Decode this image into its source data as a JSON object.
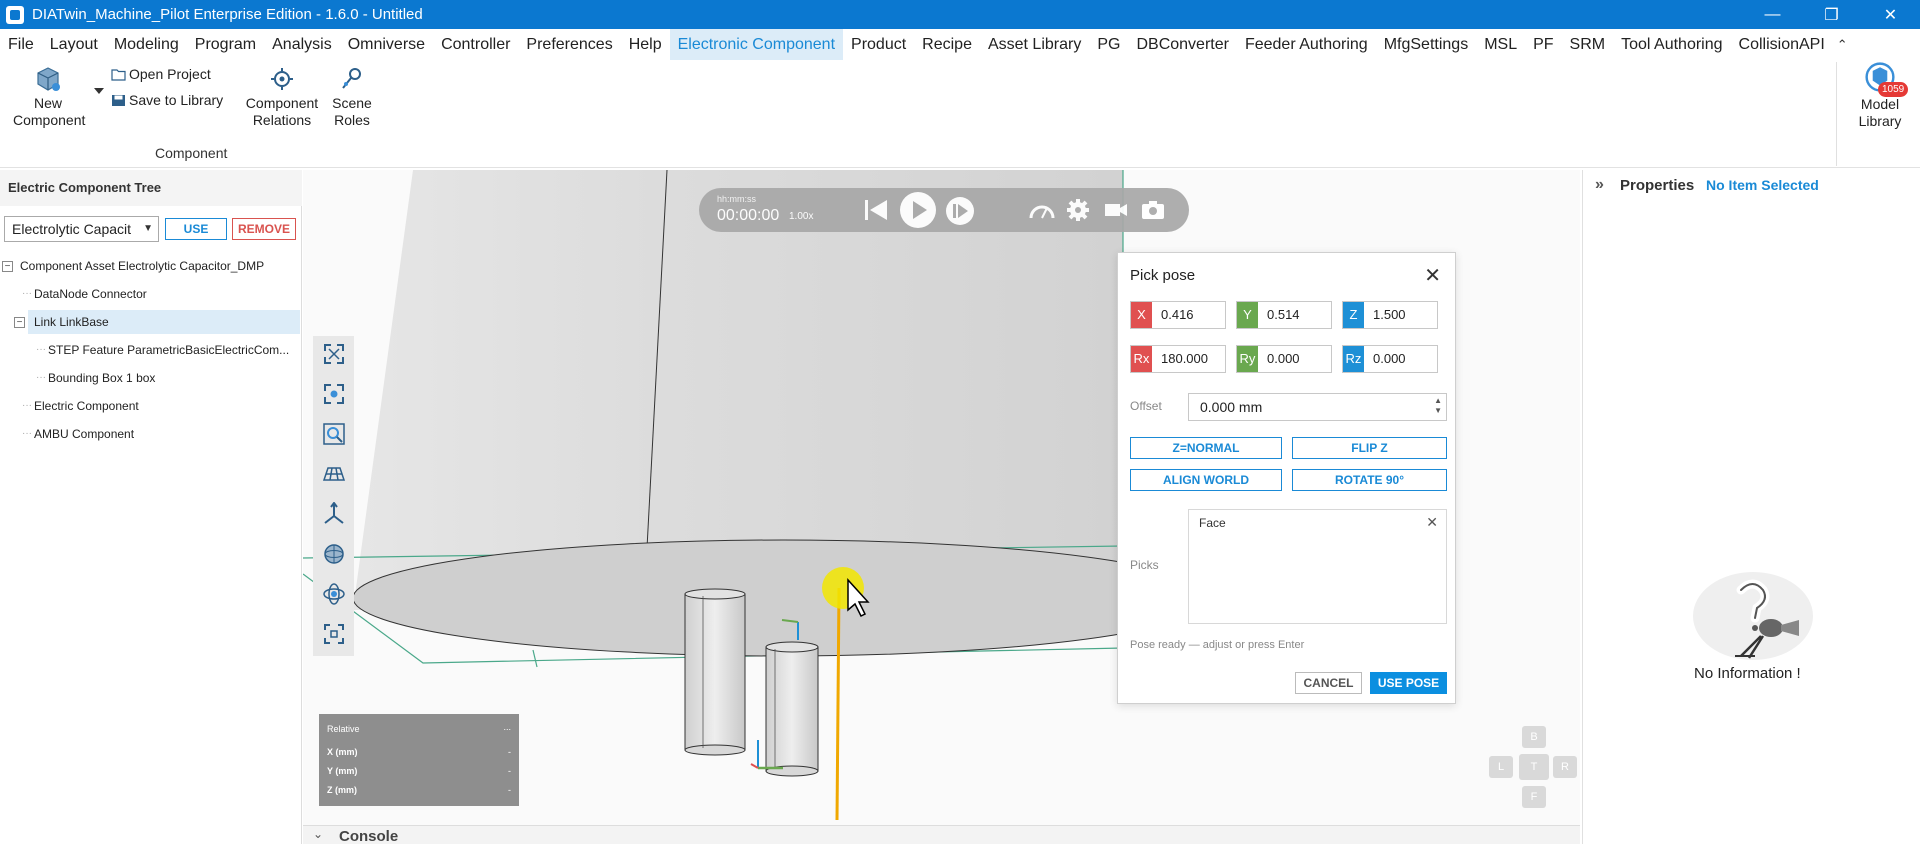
{
  "window": {
    "title": "DIATwin_Machine_Pilot Enterprise Edition - 1.6.0 - Untitled",
    "controls": [
      "—",
      "❐",
      "✕"
    ]
  },
  "menu": {
    "items": [
      "File",
      "Layout",
      "Modeling",
      "Program",
      "Analysis",
      "Omniverse",
      "Controller",
      "Preferences",
      "Help",
      "Electronic Component",
      "Product",
      "Recipe",
      "Asset Library",
      "PG",
      "DBConverter",
      "Feeder Authoring",
      "MfgSettings",
      "MSL",
      "PF",
      "SRM",
      "Tool Authoring",
      "CollisionAPI"
    ],
    "active": "Electronic Component",
    "collapse_glyph": "⌃"
  },
  "ribbon": {
    "new_component": "New Component",
    "open_project": "Open Project",
    "save_to_library": "Save to Library",
    "component_relations": "Component Relations",
    "scene_roles": "Scene Roles",
    "group_label": "Component",
    "model_library": "Model Library",
    "model_library_badge": "1059"
  },
  "left_panel": {
    "title": "Electric Component Tree",
    "combo_value": "Electrolytic Capacit",
    "use_label": "USE",
    "remove_label": "REMOVE",
    "tree": [
      {
        "label": "Component Asset  Electrolytic Capacitor_DMP",
        "expander": "−"
      },
      {
        "label": "DataNode  Connector"
      },
      {
        "label": "Link  LinkBase",
        "expander": "−",
        "selected": true
      },
      {
        "label": "STEP Feature  ParametricBasicElectricCom..."
      },
      {
        "label": "Bounding Box  1 box"
      },
      {
        "label": "Electric Component"
      },
      {
        "label": "AMBU Component"
      }
    ]
  },
  "playbar": {
    "time_label": "hh:mm:ss",
    "time": "00:00:00",
    "speed": "1.00x"
  },
  "relative_box": {
    "title": "Relative",
    "menu": "...",
    "rows": [
      {
        "label": "X (mm)",
        "value": "-"
      },
      {
        "label": "Y (mm)",
        "value": "-"
      },
      {
        "label": "Z (mm)",
        "value": "-"
      }
    ]
  },
  "navcube": {
    "top": "B",
    "left": "L",
    "center": "T",
    "right": "R",
    "bottom": "F"
  },
  "pick_pose": {
    "title": "Pick pose",
    "close": "✕",
    "x_tag": "X",
    "x": "0.416",
    "y_tag": "Y",
    "y": "0.514",
    "z_tag": "Z",
    "z": "1.500",
    "rx_tag": "Rx",
    "rx": "180.000",
    "ry_tag": "Ry",
    "ry": "0.000",
    "rz_tag": "Rz",
    "rz": "0.000",
    "offset_label": "Offset",
    "offset_value": "0.000 mm",
    "z_normal": "Z=NORMAL",
    "flip_z": "FLIP Z",
    "align_world": "ALIGN WORLD",
    "rotate_90": "ROTATE 90°",
    "picks_label": "Picks",
    "picks_item": "Face",
    "picks_remove": "✕",
    "hint": "Pose ready — adjust or press Enter",
    "cancel": "CANCEL",
    "use_pose": "USE POSE",
    "colors": {
      "x": "#e05050",
      "y": "#6aa84f",
      "z": "#1e90d6"
    }
  },
  "properties": {
    "chevron": "»",
    "title": "Properties",
    "selection": "No Item Selected",
    "no_info": "No Information !"
  },
  "console": {
    "chevron": "⌄",
    "label": "Console"
  },
  "colors": {
    "accent": "#1a8ad6",
    "titlebar": "#0b78d0",
    "remove": "#d9534f"
  }
}
